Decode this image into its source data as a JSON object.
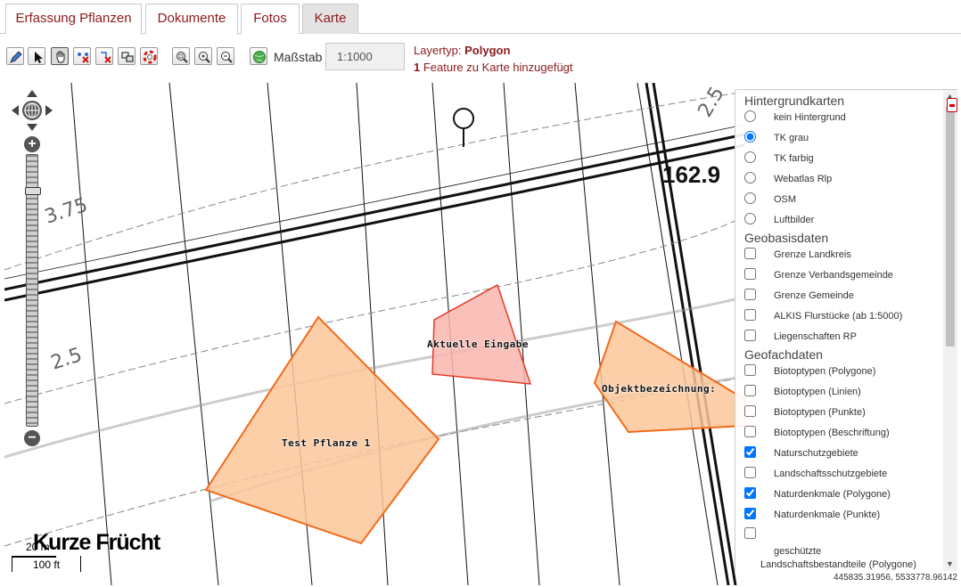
{
  "tabs": [
    {
      "label": "Erfassung Pflanzen",
      "active": false
    },
    {
      "label": "Dokumente",
      "active": false
    },
    {
      "label": "Fotos",
      "active": false
    },
    {
      "label": "Karte",
      "active": true
    }
  ],
  "toolbar": {
    "tools": [
      {
        "name": "edit-pencil-icon"
      },
      {
        "name": "select-arrow-icon"
      },
      {
        "name": "pan-hand-icon"
      },
      {
        "name": "delete-vertex-icon"
      },
      {
        "name": "delete-feature-icon"
      },
      {
        "name": "transfer-icon"
      },
      {
        "name": "lifebuoy-icon"
      }
    ],
    "zoom_tools": [
      {
        "name": "zoom-box-icon"
      },
      {
        "name": "zoom-in-icon"
      },
      {
        "name": "zoom-out-icon"
      }
    ],
    "globe_tool": {
      "name": "globe-icon"
    },
    "scale_label": "Maßstab",
    "scale_value": "1:1000",
    "layer_type_label": "Layertyp:",
    "layer_type_value": "Polygon",
    "feature_count": "1",
    "feature_message": "Feature zu Karte hinzugefügt"
  },
  "map": {
    "contour_labels": [
      "3.75",
      "2.5",
      "2.5"
    ],
    "height_label": "162.9",
    "polygon_labels": [
      "Aktuelle Eingabe",
      "Objektbezeichnung:",
      "Test Pflanze 1"
    ],
    "area_label": "Kurze Frücht",
    "scale": {
      "top": "20 m",
      "bottom": "100 ft"
    },
    "coordinates": "445835.31956, 5533778.96142",
    "colors": {
      "polygon_fill": "#fcc79a",
      "polygon_stroke": "#f26a1b",
      "current_fill": "#f9b6ae",
      "current_stroke": "#e53a2a"
    }
  },
  "layers": {
    "background_title": "Hintergrundkarten",
    "background": [
      {
        "label": "kein Hintergrund",
        "checked": false
      },
      {
        "label": "TK grau",
        "checked": true
      },
      {
        "label": "TK farbig",
        "checked": false
      },
      {
        "label": "Webatlas Rlp",
        "checked": false
      },
      {
        "label": "OSM",
        "checked": false
      },
      {
        "label": "Luftbilder",
        "checked": false
      }
    ],
    "base_title": "Geobasisdaten",
    "base": [
      {
        "label": "Grenze Landkreis",
        "checked": false
      },
      {
        "label": "Grenze Verbandsgemeinde",
        "checked": false
      },
      {
        "label": "Grenze Gemeinde",
        "checked": false
      },
      {
        "label": "ALKIS Flurstücke (ab 1:5000)",
        "checked": false
      },
      {
        "label": "Liegenschaften RP",
        "checked": false
      }
    ],
    "special_title": "Geofachdaten",
    "special": [
      {
        "label": "Biotoptypen (Polygone)",
        "checked": false
      },
      {
        "label": "Biotoptypen (Linien)",
        "checked": false
      },
      {
        "label": "Biotoptypen (Punkte)",
        "checked": false
      },
      {
        "label": "Biotoptypen (Beschriftung)",
        "checked": false
      },
      {
        "label": "Naturschutzgebiete",
        "checked": true
      },
      {
        "label": "Landschaftsschutzgebiete",
        "checked": false
      },
      {
        "label": "Naturdenkmale (Polygone)",
        "checked": true
      },
      {
        "label": "Naturdenkmale (Punkte)",
        "checked": true
      },
      {
        "label": "",
        "checked": false
      }
    ],
    "extra_line1": "geschützte",
    "extra_line2": "Landschaftsbestandteile (Polygone)"
  }
}
